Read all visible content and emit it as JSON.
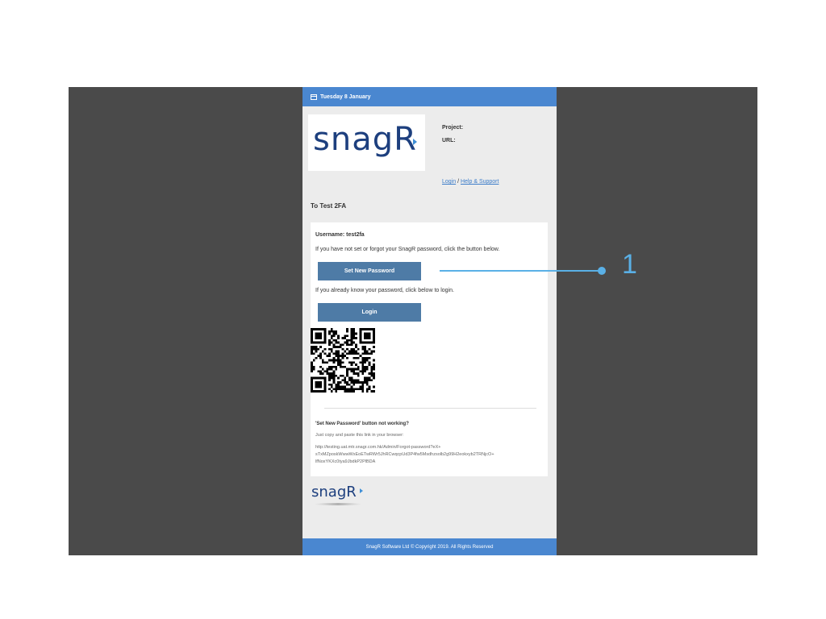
{
  "header": {
    "date": "Tuesday 8 January"
  },
  "logo": {
    "text": "snagR"
  },
  "meta": {
    "project_label": "Project:",
    "url_label": "URL:"
  },
  "links": {
    "login": "Login",
    "separator": " / ",
    "help": "Help & Support"
  },
  "greeting": "To Test 2FA",
  "card": {
    "username_line": "Username: test2fa",
    "forgot_text": "If you have not set or forgot your SnagR password, click the button below.",
    "set_password_button": "Set New Password",
    "know_text": "If you already know your password, click below to login.",
    "login_button": "Login",
    "not_working_title": "'Set New Password' button not working?",
    "copy_paste_text": "Just copy and paste this link in your browser:",
    "link_line1": "http://testing.uat.mtr.snagr.com.hk/Admin/Forgot-password?eX+",
    "link_line2": "sTxMZposkWwwWxEoETwRWr5JhRCwqcpUd3P4fw5Msdhzsolb2g99H2eokxyb2TRNjcO+",
    "link_line3": "lfNoxYKXc0tya9JbdkP2PlBDA"
  },
  "footer": {
    "logo_text": "snagR",
    "copyright": "SnagR Software Ltd © Copyright 2019. All Rights Reserved"
  },
  "callout": {
    "number": "1",
    "color": "#5ab0e6"
  },
  "colors": {
    "header_blue": "#4a87d0",
    "button_blue": "#4e7ba6",
    "logo_navy": "#1d3f7e"
  },
  "icons": {
    "calendar": "calendar-icon",
    "qr": "qr-code"
  }
}
